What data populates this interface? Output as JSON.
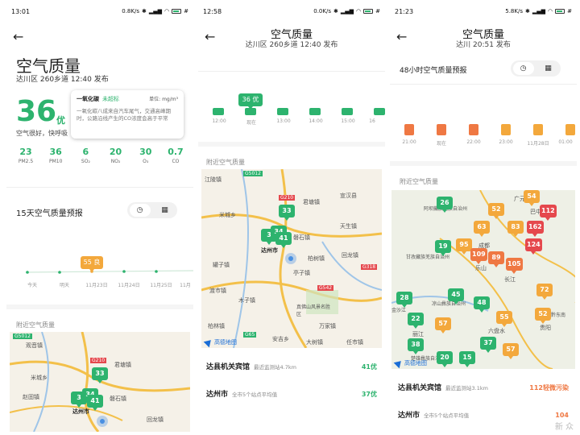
{
  "panel1": {
    "status": {
      "time": "13:01",
      "net": "0.8K/s",
      "batt": "#"
    },
    "title": "空气质量",
    "subtitle": "达川区 260乡道 12:40 发布",
    "aqi": "36",
    "level": "优",
    "desc": "空气很好，快呼吸",
    "tooltip": {
      "name": "一氧化碳",
      "status": "未超标",
      "unit": "单位: mg/m³",
      "body": "一氧化碳八成来自汽车尾气，交通高峰期时，公路沿线产生的CO浓度会高于平常"
    },
    "pollutants": [
      {
        "value": "23",
        "name": "PM2.5"
      },
      {
        "value": "36",
        "name": "PM10"
      },
      {
        "value": "6",
        "name": "SO₂"
      },
      {
        "value": "20",
        "name": "NO₂"
      },
      {
        "value": "30",
        "name": "O₃"
      },
      {
        "value": "0.7",
        "name": "CO"
      }
    ],
    "forecast_title": "15天空气质量预报",
    "forecast_label": "55 良",
    "forecast_ticks": [
      "今天",
      "明天",
      "11月23日",
      "11月24日",
      "11月25日",
      "11月"
    ],
    "nearby_label": "附近空气质量",
    "map_places": [
      "G5012",
      "观音镇",
      "G210",
      "君塘镇",
      "米城乡",
      "赵固镇",
      "磐石镇",
      "达州市",
      "回龙镇"
    ],
    "markers": [
      "33",
      "3",
      "34",
      "41"
    ]
  },
  "panel2": {
    "status": {
      "time": "12:58",
      "net": "0.0K/s",
      "batt": "#"
    },
    "title": "空气质量",
    "subtitle": "达川区 260乡道 12:40 发布",
    "chart_label": "36 优",
    "chart_ticks": [
      "12:00",
      "现在",
      "13:00",
      "14:00",
      "15:00",
      "16"
    ],
    "nearby_label": "附近空气质量",
    "map_places": [
      "G5012",
      "江陵镇",
      "G210",
      "君塘镇",
      "宣汉县",
      "米城乡",
      "天生镇",
      "磐石镇",
      "达州市",
      "柏树镇",
      "罐子镇",
      "亭子镇",
      "回龙镇",
      "渡市镇",
      "G542",
      "G318",
      "木子镇",
      "真佛山风景名胜区",
      "柏林镇",
      "万家镇",
      "安吉乡",
      "G65",
      "大树镇",
      "任市镇"
    ],
    "markers": [
      "33",
      "3",
      "34",
      "41"
    ],
    "map_logo": "高德地图",
    "stations": [
      {
        "name": "达县机关宾馆",
        "meta": "最近监测站4.7km",
        "value": "41优",
        "color": "#2db36e"
      },
      {
        "name": "达州市",
        "meta": "全市5个站点平均值",
        "value": "37优",
        "color": "#2db36e"
      }
    ]
  },
  "panel3": {
    "status": {
      "time": "21:23",
      "net": "5.8K/s",
      "batt": "#"
    },
    "title": "空气质量",
    "subtitle": "达川 20:51 发布",
    "forecast_title": "48小时空气质量预报",
    "chart_ticks": [
      "21:00",
      "现在",
      "22:00",
      "23:00",
      "11月28日",
      "01:00"
    ],
    "nearby_label": "附近空气质量",
    "map_places": [
      "广元",
      "阿坝藏族羌族自治州",
      "巴中",
      "成都",
      "甘孜藏族羌族自治州",
      "乐山",
      "长江",
      "凉山彝族自治州",
      "金沙江",
      "贵阳",
      "六盘水",
      "黔东南",
      "丽江",
      "楚雄彝族自治州"
    ],
    "markers": [
      {
        "v": "26",
        "c": "g"
      },
      {
        "v": "54",
        "c": "y"
      },
      {
        "v": "52",
        "c": "y"
      },
      {
        "v": "112",
        "c": "r"
      },
      {
        "v": "63",
        "c": "y"
      },
      {
        "v": "83",
        "c": "y"
      },
      {
        "v": "162",
        "c": "r"
      },
      {
        "v": "19",
        "c": "g"
      },
      {
        "v": "95",
        "c": "y"
      },
      {
        "v": "124",
        "c": "r"
      },
      {
        "v": "109",
        "c": "o"
      },
      {
        "v": "89",
        "c": "o"
      },
      {
        "v": "105",
        "c": "o"
      },
      {
        "v": "72",
        "c": "y"
      },
      {
        "v": "45",
        "c": "g"
      },
      {
        "v": "28",
        "c": "g"
      },
      {
        "v": "48",
        "c": "g"
      },
      {
        "v": "22",
        "c": "g"
      },
      {
        "v": "55",
        "c": "y"
      },
      {
        "v": "52",
        "c": "y"
      },
      {
        "v": "57",
        "c": "y"
      },
      {
        "v": "38",
        "c": "g"
      },
      {
        "v": "37",
        "c": "g"
      },
      {
        "v": "57",
        "c": "y"
      },
      {
        "v": "15",
        "c": "g"
      },
      {
        "v": "20",
        "c": "g"
      }
    ],
    "map_logo": "高德地图",
    "stations": [
      {
        "name": "达县机关宾馆",
        "meta": "最近监测站3.1km",
        "value": "112轻微污染",
        "color": "#ef7843"
      },
      {
        "name": "达州市",
        "meta": "全市5个站点平均值",
        "value": "104",
        "color": "#ef7843"
      }
    ],
    "watermark": "新 众"
  },
  "colors": {
    "good": "#2db36e",
    "moderate": "#f3a83c",
    "light": "#ef7843",
    "heavy": "#e5484d"
  }
}
